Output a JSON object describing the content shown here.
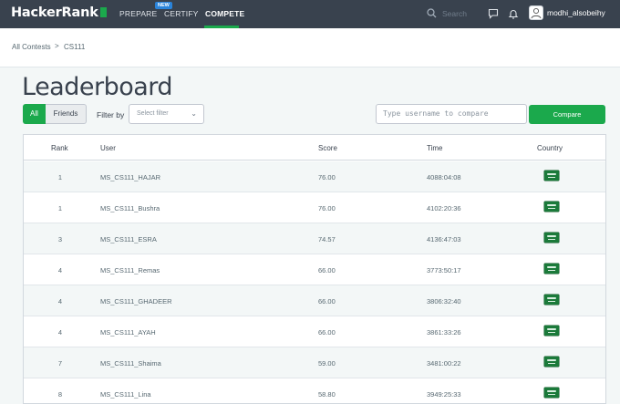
{
  "nav": {
    "logo_text": "HackerRank",
    "prepare": "PREPARE",
    "new_badge": "NEW",
    "certify": "CERTIFY",
    "compete": "COMPETE",
    "search_placeholder": "Search",
    "username": "modhi_alsobeihy",
    "accent_color": "#1ba94c",
    "bar_color": "#39424e"
  },
  "breadcrumb": {
    "root": "All Contests",
    "separator": ">",
    "current": "CS111"
  },
  "page_title": "Leaderboard",
  "filters": {
    "all": "All",
    "friends": "Friends",
    "filter_by": "Filter by",
    "select_placeholder": "Select filter",
    "compare_placeholder": "Type username to compare",
    "compare_button": "Compare"
  },
  "table": {
    "headers": [
      "Rank",
      "User",
      "Score",
      "Time",
      "Country"
    ],
    "rows": [
      {
        "rank": "1",
        "user": "MS_CS111_HAJAR",
        "score": "76.00",
        "time": "4088:04:08",
        "country": "saudi-arabia-flag-icon"
      },
      {
        "rank": "1",
        "user": "MS_CS111_Bushra",
        "score": "76.00",
        "time": "4102:20:36",
        "country": "saudi-arabia-flag-icon"
      },
      {
        "rank": "3",
        "user": "MS_CS111_ESRA",
        "score": "74.57",
        "time": "4136:47:03",
        "country": "saudi-arabia-flag-icon"
      },
      {
        "rank": "4",
        "user": "MS_CS111_Remas",
        "score": "66.00",
        "time": "3773:50:17",
        "country": "saudi-arabia-flag-icon"
      },
      {
        "rank": "4",
        "user": "MS_CS111_GHADEER",
        "score": "66.00",
        "time": "3806:32:40",
        "country": "saudi-arabia-flag-icon"
      },
      {
        "rank": "4",
        "user": "MS_CS111_AYAH",
        "score": "66.00",
        "time": "3861:33:26",
        "country": "saudi-arabia-flag-icon"
      },
      {
        "rank": "7",
        "user": "MS_CS111_Shaima",
        "score": "59.00",
        "time": "3481:00:22",
        "country": "saudi-arabia-flag-icon"
      },
      {
        "rank": "8",
        "user": "MS_CS111_Lina",
        "score": "58.80",
        "time": "3949:25:33",
        "country": "saudi-arabia-flag-icon"
      }
    ]
  }
}
